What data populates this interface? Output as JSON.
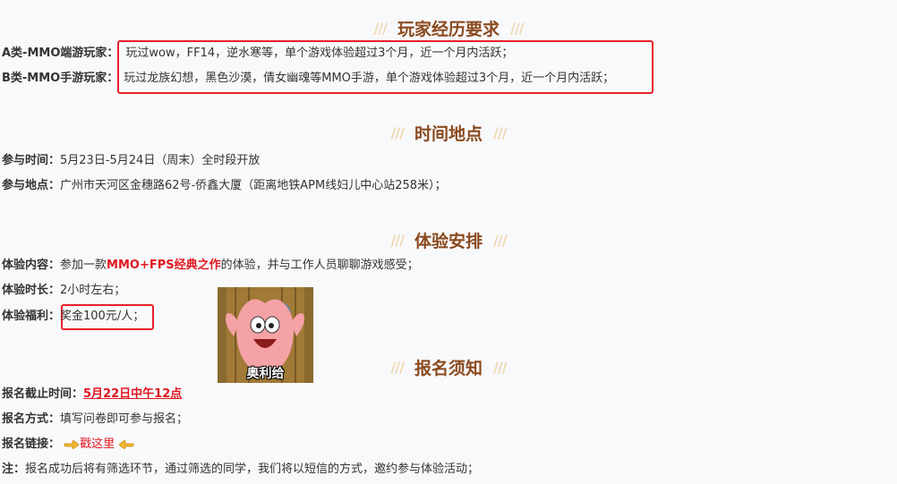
{
  "sections": {
    "requirements": {
      "deco": "///",
      "title": "玩家经历要求"
    },
    "time_place": {
      "deco": "///",
      "title": "时间地点"
    },
    "arrangement": {
      "deco": "///",
      "title": "体验安排"
    },
    "signup": {
      "deco": "///",
      "title": "报名须知"
    }
  },
  "requirements": {
    "a_label": "A类-MMO端游玩家：",
    "a_value": "玩过wow，FF14，逆水寒等，单个游戏体验超过3个月，近一个月内活跃；",
    "b_label": "B类-MMO手游玩家：",
    "b_value": "玩过龙族幻想，黑色沙漠，倩女幽魂等MMO手游，单个游戏体验超过3个月，近一个月内活跃；"
  },
  "time_place": {
    "time_label": "参与时间：",
    "time_value": "5月23日-5月24日（周末）全时段开放",
    "place_label": "参与地点：",
    "place_value": "广州市天河区金穗路62号-侨鑫大厦（距离地铁APM线妇儿中心站258米）；"
  },
  "arrangement": {
    "content_label": "体验内容：",
    "content_pre": "参加一款",
    "content_highlight": "MMO+FPS经典之作",
    "content_post": "的体验，并与工作人员聊聊游戏感受；",
    "duration_label": "体验时长：",
    "duration_value": "2小时左右；",
    "benefit_label": "体验福利：",
    "benefit_value": "奖金100元/人；"
  },
  "signup": {
    "deadline_label": "报名截止时间：",
    "deadline_value": "5月22日中午12点",
    "method_label": "报名方式：",
    "method_value": "填写问卷即可参与报名；",
    "link_label": "报名链接：",
    "link_text": "戳这里",
    "note_label": "注：",
    "note_value": "报名成功后将有筛选环节，通过筛选的同学，我们将以短信的方式，邀约参与体验活动；"
  },
  "sticker": {
    "caption": "奥利给"
  },
  "colors": {
    "accent_red": "#e0171f",
    "title_brown": "#8a4a1e",
    "deco_tan": "#f0d7b0",
    "box_red": "#e8202a"
  }
}
